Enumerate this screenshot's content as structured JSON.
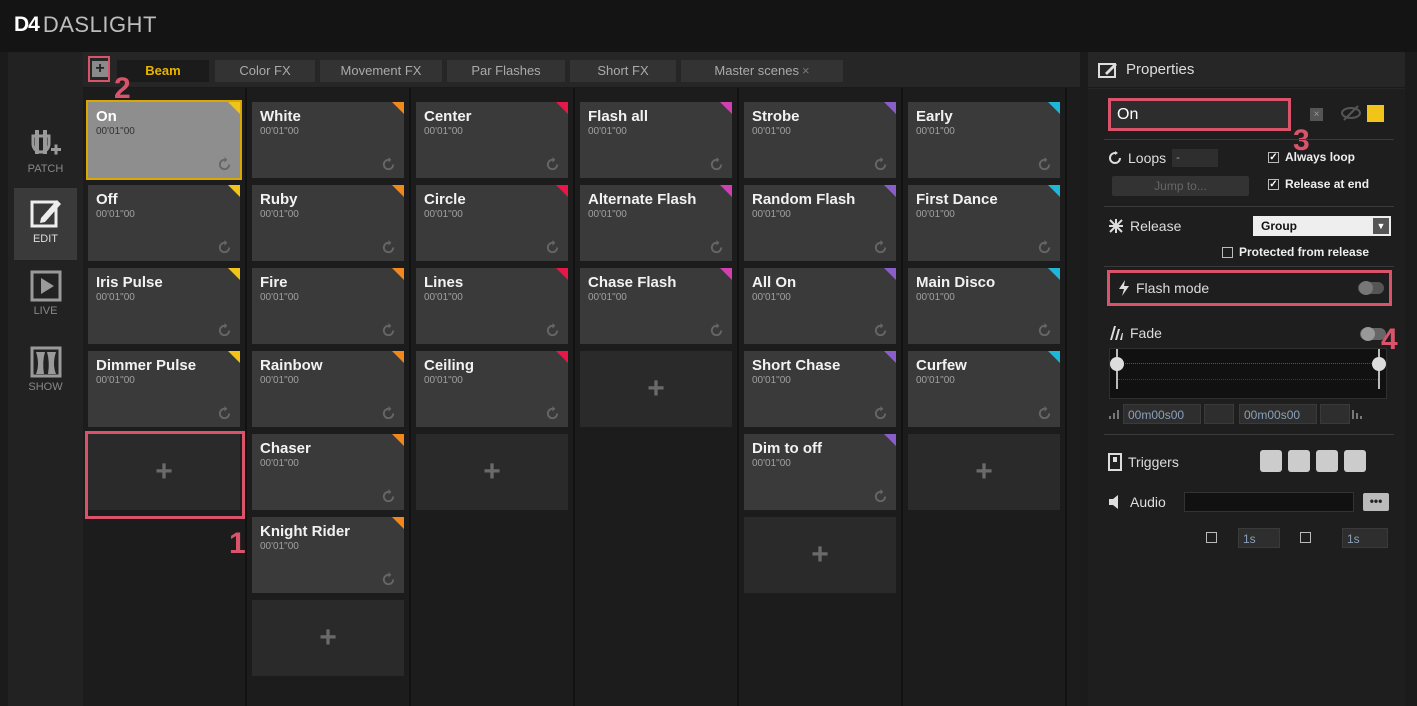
{
  "app": {
    "logo_mark": "D4",
    "name": "DASLIGHT"
  },
  "nav": [
    {
      "label": "PATCH",
      "icon": "patch-icon"
    },
    {
      "label": "EDIT",
      "icon": "edit-icon"
    },
    {
      "label": "LIVE",
      "icon": "play-icon"
    },
    {
      "label": "SHOW",
      "icon": "show-icon"
    }
  ],
  "tabs": {
    "add": "+",
    "items": [
      {
        "label": "Beam"
      },
      {
        "label": "Color FX"
      },
      {
        "label": "Movement FX"
      },
      {
        "label": "Par Flashes"
      },
      {
        "label": "Short FX"
      },
      {
        "label": "Master scenes",
        "close": "×"
      }
    ]
  },
  "columns": [
    {
      "color": "#f0c419",
      "scenes": [
        {
          "name": "On",
          "time": "00'01\"00"
        },
        {
          "name": "Off",
          "time": "00'01\"00"
        },
        {
          "name": "Iris Pulse",
          "time": "00'01\"00"
        },
        {
          "name": "Dimmer Pulse",
          "time": "00'01\"00"
        }
      ]
    },
    {
      "color": "#f0881e",
      "scenes": [
        {
          "name": "White",
          "time": "00'01\"00"
        },
        {
          "name": "Ruby",
          "time": "00'01\"00"
        },
        {
          "name": "Fire",
          "time": "00'01\"00"
        },
        {
          "name": "Rainbow",
          "time": "00'01\"00"
        },
        {
          "name": "Chaser",
          "time": "00'01\"00"
        },
        {
          "name": "Knight Rider",
          "time": "00'01\"00"
        }
      ]
    },
    {
      "color": "#e8174a",
      "scenes": [
        {
          "name": "Center",
          "time": "00'01\"00"
        },
        {
          "name": "Circle",
          "time": "00'01\"00"
        },
        {
          "name": "Lines",
          "time": "00'01\"00"
        },
        {
          "name": "Ceiling",
          "time": "00'01\"00"
        }
      ]
    },
    {
      "color": "#d23fb0",
      "scenes": [
        {
          "name": "Flash all",
          "time": "00'01\"00"
        },
        {
          "name": "Alternate Flash",
          "time": "00'01\"00"
        },
        {
          "name": "Chase Flash",
          "time": "00'01\"00"
        }
      ]
    },
    {
      "color": "#8a5ec8",
      "scenes": [
        {
          "name": "Strobe",
          "time": "00'01\"00"
        },
        {
          "name": "Random Flash",
          "time": "00'01\"00"
        },
        {
          "name": "All On",
          "time": "00'01\"00"
        },
        {
          "name": "Short Chase",
          "time": "00'01\"00"
        },
        {
          "name": "Dim to off",
          "time": "00'01\"00"
        }
      ]
    },
    {
      "color": "#1fb6d8",
      "scenes": [
        {
          "name": "Early",
          "time": "00'01\"00"
        },
        {
          "name": "First Dance",
          "time": "00'01\"00"
        },
        {
          "name": "Main Disco",
          "time": "00'01\"00"
        },
        {
          "name": "Curfew",
          "time": "00'01\"00"
        }
      ]
    }
  ],
  "add_cell": "+",
  "callouts": [
    "1",
    "2",
    "3",
    "4"
  ],
  "properties": {
    "title": "Properties",
    "name_value": "On",
    "scene_color": "#f0c419",
    "loops_label": "Loops",
    "loops_value": "-",
    "always_loop": "Always loop",
    "release_at_end": "Release at end",
    "jump_to": "Jump to...",
    "release_label": "Release",
    "release_value": "Group",
    "protected": "Protected from release",
    "flash_mode": "Flash mode",
    "fade": "Fade",
    "fade_in": "00m00s00",
    "fade_out": "00m00s00",
    "triggers": "Triggers",
    "audio": "Audio",
    "audio_more": "•••",
    "step1": "1s",
    "step2": "1s"
  }
}
